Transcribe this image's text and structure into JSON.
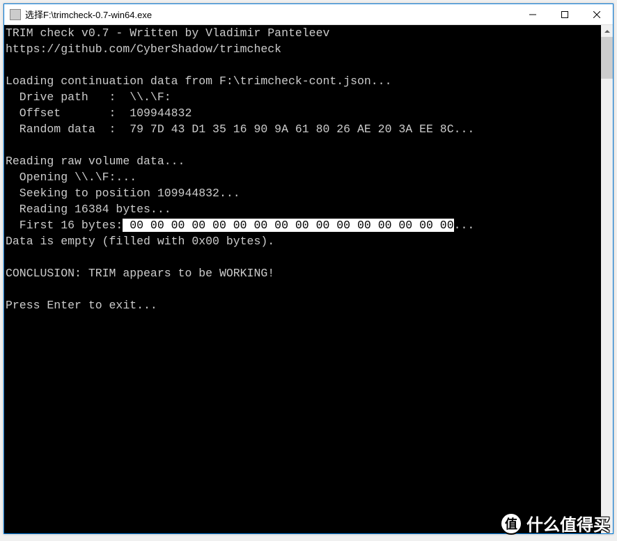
{
  "window": {
    "title": "选择F:\\trimcheck-0.7-win64.exe"
  },
  "console": {
    "line1": "TRIM check v0.7 - Written by Vladimir Panteleev",
    "line2": "https://github.com/CyberShadow/trimcheck",
    "line3": "",
    "line4": "Loading continuation data from F:\\trimcheck-cont.json...",
    "line5": "  Drive path   :  \\\\.\\F:",
    "line6": "  Offset       :  109944832",
    "line7": "  Random data  :  79 7D 43 D1 35 16 90 9A 61 80 26 AE 20 3A EE 8C...",
    "line8": "",
    "line9": "Reading raw volume data...",
    "line10": "  Opening \\\\.\\F:...",
    "line11": "  Seeking to position 109944832...",
    "line12": "  Reading 16384 bytes...",
    "line13_prefix": "  First 16 bytes:",
    "line13_highlight": " 00 00 00 00 00 00 00 00 00 00 00 00 00 00 00 00",
    "line13_suffix": "...",
    "line14": "Data is empty (filled with 0x00 bytes).",
    "line15": "",
    "line16": "CONCLUSION: TRIM appears to be WORKING!",
    "line17": "",
    "line18": "Press Enter to exit..."
  },
  "watermark": {
    "badge": "值",
    "text": "什么值得买"
  }
}
